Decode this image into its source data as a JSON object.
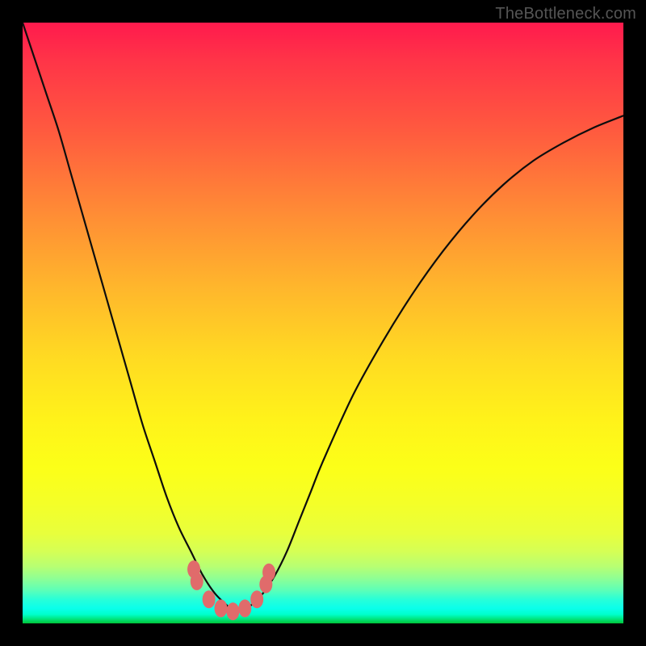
{
  "watermark": "TheBottleneck.com",
  "colors": {
    "frame": "#000000",
    "curve": "#0d0d0d",
    "marker_fill": "#e06b6b",
    "gradient_top": "#ff1a4d",
    "gradient_bottom": "#00c23a"
  },
  "chart_data": {
    "type": "line",
    "title": "",
    "xlabel": "",
    "ylabel": "",
    "xlim": [
      0,
      100
    ],
    "ylim": [
      0,
      100
    ],
    "x": [
      0,
      2,
      4,
      6,
      8,
      10,
      12,
      14,
      16,
      18,
      20,
      22,
      24,
      26,
      28,
      30,
      32,
      34,
      35,
      36,
      38,
      40,
      42,
      44,
      46,
      48,
      50,
      55,
      60,
      65,
      70,
      75,
      80,
      85,
      90,
      95,
      100
    ],
    "y": [
      100,
      94,
      88,
      82,
      75,
      68,
      61,
      54,
      47,
      40,
      33,
      27,
      21,
      16,
      12,
      8,
      5,
      3,
      2,
      2,
      3,
      5,
      8,
      12,
      17,
      22,
      27,
      38,
      47,
      55,
      62,
      68,
      73,
      77,
      80,
      82.5,
      84.5
    ],
    "minimum_x": 35,
    "markers": [
      {
        "x": 28.5,
        "y": 9.0
      },
      {
        "x": 29.0,
        "y": 7.0
      },
      {
        "x": 31.0,
        "y": 4.0
      },
      {
        "x": 33.0,
        "y": 2.5
      },
      {
        "x": 35.0,
        "y": 2.0
      },
      {
        "x": 37.0,
        "y": 2.5
      },
      {
        "x": 39.0,
        "y": 4.0
      },
      {
        "x": 40.5,
        "y": 6.5
      },
      {
        "x": 41.0,
        "y": 8.5
      }
    ],
    "background_gradient": {
      "top": "red",
      "middle": "yellow",
      "bottom": "green"
    }
  }
}
